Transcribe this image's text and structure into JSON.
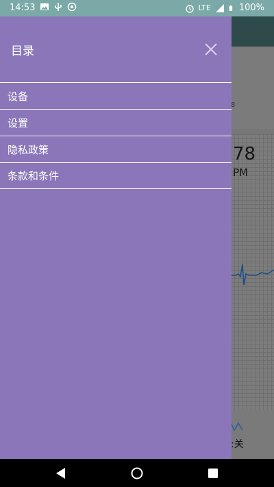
{
  "status_bar": {
    "time": "14:53",
    "network": "LTE",
    "battery": "100%",
    "icons": [
      "image-icon",
      "usb-debug-icon",
      "sync-icon",
      "alarm-icon",
      "signal-icon",
      "battery-icon"
    ]
  },
  "background": {
    "small_text": "8",
    "reading": "78",
    "unit": "PM",
    "status_text": ":关"
  },
  "drawer": {
    "title": "目录",
    "close_icon": "close-icon",
    "items": [
      {
        "label": "设备"
      },
      {
        "label": "设置"
      },
      {
        "label": "隐私政策"
      },
      {
        "label": "条款和条件"
      }
    ]
  },
  "nav_bar": {
    "icons": [
      "back-icon",
      "home-icon",
      "recents-icon"
    ]
  },
  "colors": {
    "drawer_bg": "#8a76b8",
    "status_bar_bg": "#7aa9a7",
    "text": "#ffffff"
  }
}
